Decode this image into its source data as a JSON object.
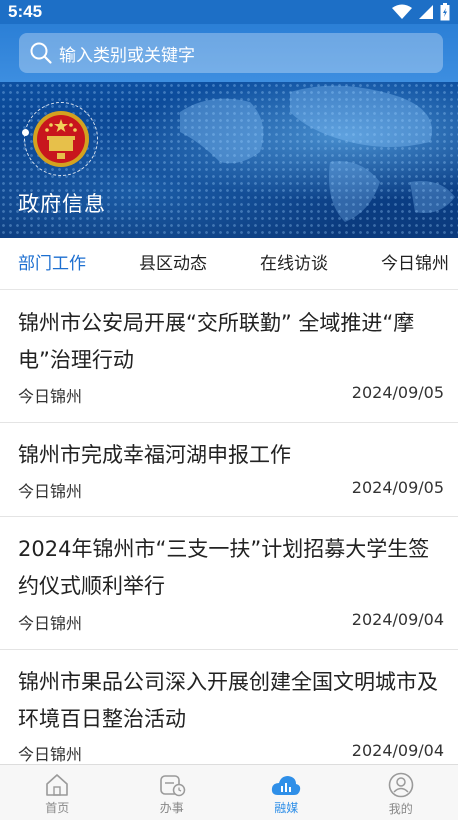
{
  "status_bar": {
    "time": "5:45"
  },
  "search": {
    "placeholder": "输入类别或关键字"
  },
  "banner": {
    "title": "政府信息"
  },
  "tabs": [
    {
      "label": "部门工作",
      "active": true
    },
    {
      "label": "县区动态",
      "active": false
    },
    {
      "label": "在线访谈",
      "active": false
    },
    {
      "label": "今日锦州",
      "active": false
    }
  ],
  "news": [
    {
      "title": "锦州市公安局开展“交所联勤” 全域推进“摩电”治理行动",
      "source": "今日锦州",
      "date": "2024/09/05"
    },
    {
      "title": "锦州市完成幸福河湖申报工作",
      "source": "今日锦州",
      "date": "2024/09/05"
    },
    {
      "title": "2024年锦州市“三支一扶”计划招募大学生签约仪式顺利举行",
      "source": "今日锦州",
      "date": "2024/09/04"
    },
    {
      "title": "锦州市果品公司深入开展创建全国文明城市及环境百日整治活动",
      "source": "今日锦州",
      "date": "2024/09/04"
    }
  ],
  "bottom_nav": [
    {
      "label": "首页",
      "icon": "home-icon",
      "active": false
    },
    {
      "label": "办事",
      "icon": "service-icon",
      "active": false
    },
    {
      "label": "融媒",
      "icon": "media-cloud-icon",
      "active": true
    },
    {
      "label": "我的",
      "icon": "user-icon",
      "active": false
    }
  ],
  "colors": {
    "primary": "#1d6fd0",
    "active_nav": "#2f8fe8",
    "status_bar": "#1d6fc6"
  }
}
